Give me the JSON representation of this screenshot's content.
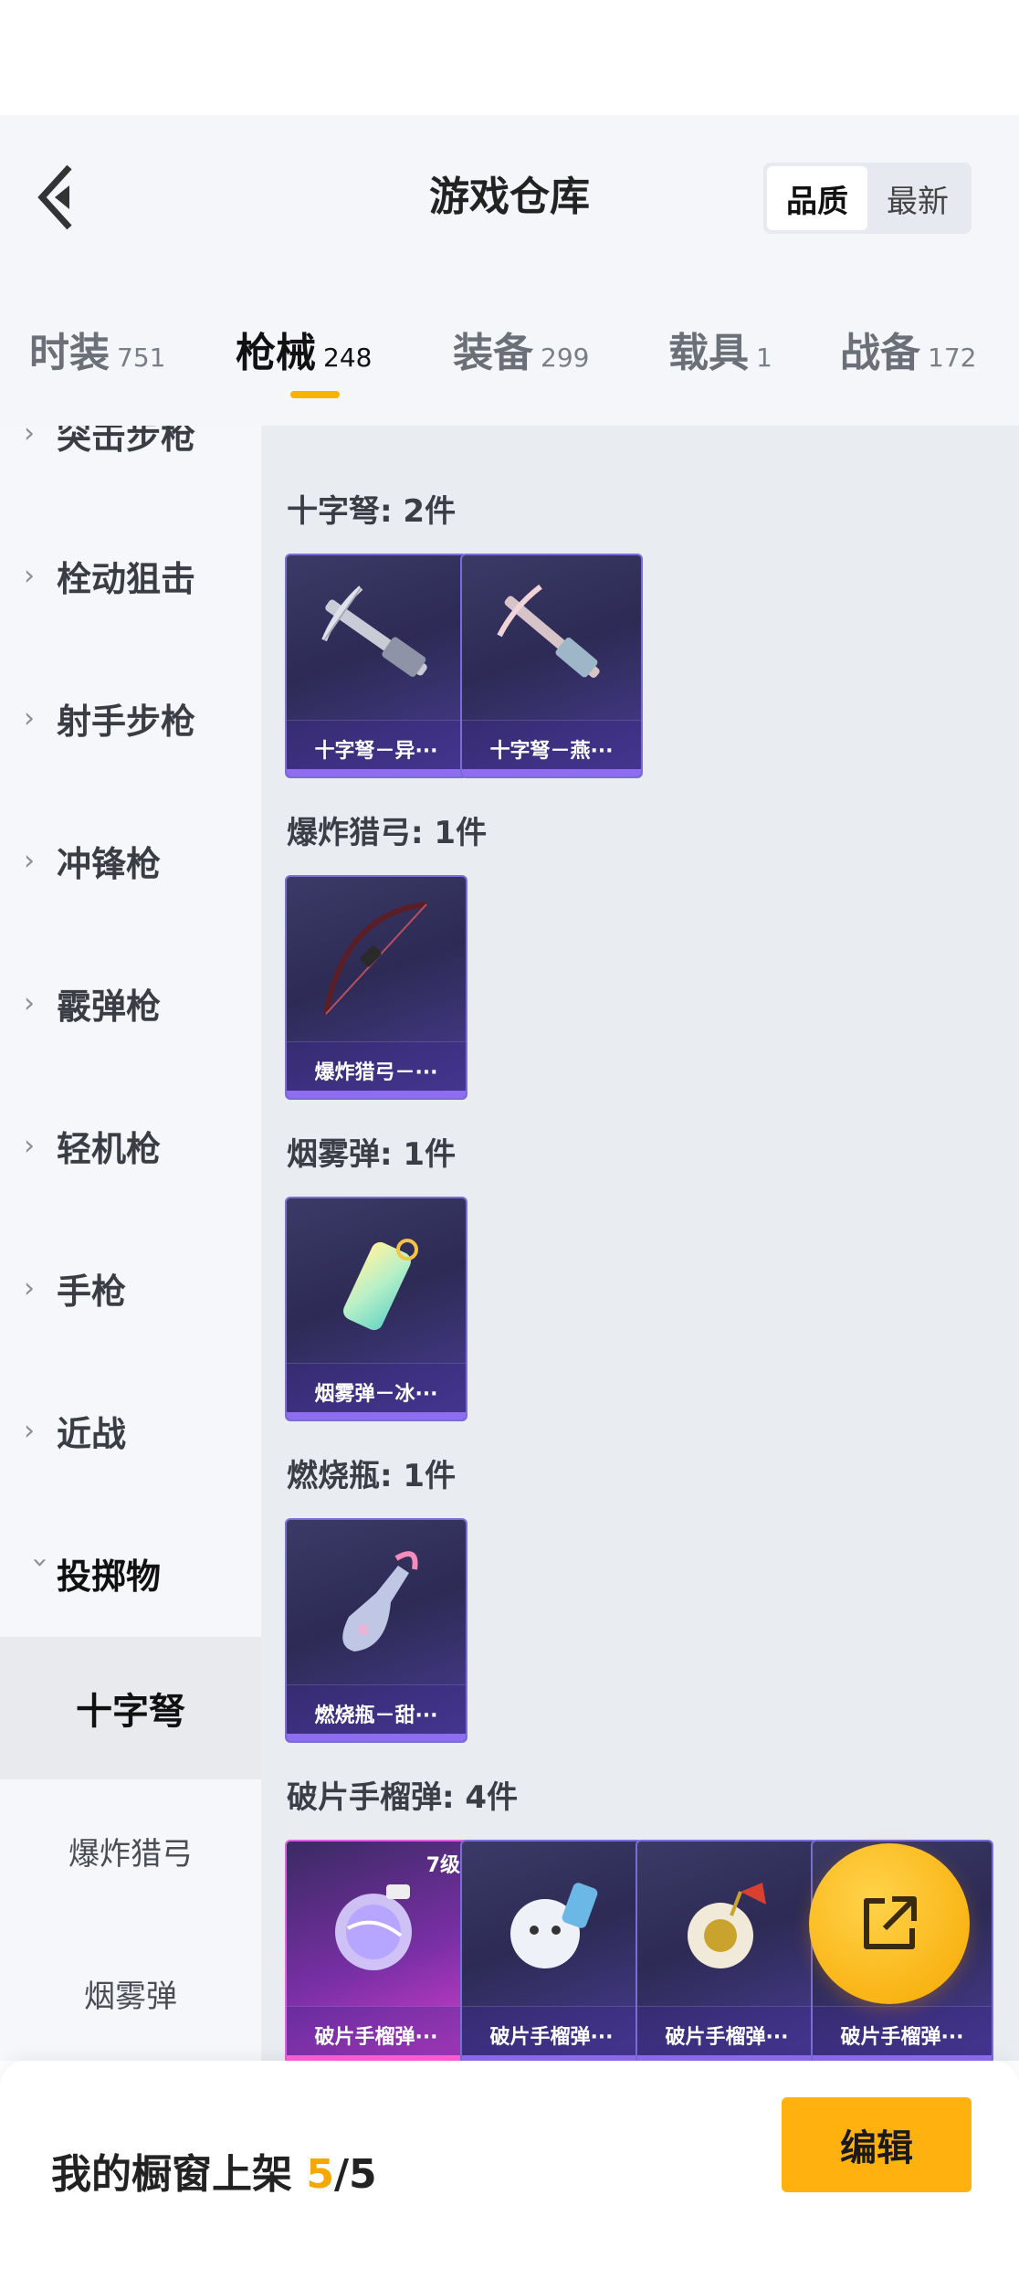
{
  "header": {
    "title": "游戏仓库",
    "sort": {
      "options": [
        "品质",
        "最新"
      ],
      "selected": "品质"
    }
  },
  "tabs": [
    {
      "label": "时装",
      "count": "751"
    },
    {
      "label": "枪械",
      "count": "248",
      "active": true
    },
    {
      "label": "装备",
      "count": "299"
    },
    {
      "label": "载具",
      "count": "1"
    },
    {
      "label": "战备",
      "count": "172"
    }
  ],
  "sidebar": {
    "items": [
      {
        "label": "突击步枪",
        "state": "collapsed"
      },
      {
        "label": "栓动狙击",
        "state": "collapsed"
      },
      {
        "label": "射手步枪",
        "state": "collapsed"
      },
      {
        "label": "冲锋枪",
        "state": "collapsed"
      },
      {
        "label": "霰弹枪",
        "state": "collapsed"
      },
      {
        "label": "轻机枪",
        "state": "collapsed"
      },
      {
        "label": "手枪",
        "state": "collapsed"
      },
      {
        "label": "近战",
        "state": "collapsed"
      },
      {
        "label": "投掷物",
        "state": "expanded"
      }
    ],
    "subitems": [
      {
        "label": "十字弩",
        "active": true
      },
      {
        "label": "爆炸猎弓"
      },
      {
        "label": "烟雾弹"
      }
    ]
  },
  "groups": [
    {
      "title": "十字弩: 2件",
      "items": [
        {
          "name": "十字弩－异···",
          "icon": "crossbow-icon"
        },
        {
          "name": "十字弩－燕···",
          "icon": "crossbow-icon"
        }
      ]
    },
    {
      "title": "爆炸猎弓: 1件",
      "items": [
        {
          "name": "爆炸猎弓－···",
          "icon": "bow-icon"
        }
      ]
    },
    {
      "title": "烟雾弹: 1件",
      "items": [
        {
          "name": "烟雾弹－冰···",
          "icon": "smoke-grenade-icon"
        }
      ]
    },
    {
      "title": "燃烧瓶: 1件",
      "items": [
        {
          "name": "燃烧瓶－甜···",
          "icon": "molotov-icon"
        }
      ]
    },
    {
      "title": "破片手榴弹: 4件",
      "items": [
        {
          "name": "破片手榴弹···",
          "icon": "grenade-icon",
          "level": "7级",
          "rarity": "pink"
        },
        {
          "name": "破片手榴弹···",
          "icon": "grenade-icon"
        },
        {
          "name": "破片手榴弹···",
          "icon": "grenade-icon"
        },
        {
          "name": "破片手榴弹···",
          "icon": "grenade-icon"
        }
      ]
    }
  ],
  "bottom": {
    "label_prefix": "我的橱窗上架 ",
    "shown": "5",
    "separator": "/",
    "total": "5",
    "edit_label": "编辑"
  },
  "colors": {
    "accent": "#f8b300",
    "card_purple": "#4a3c95",
    "card_pink": "#d93fcf",
    "content_bg": "#e9ecf1"
  }
}
